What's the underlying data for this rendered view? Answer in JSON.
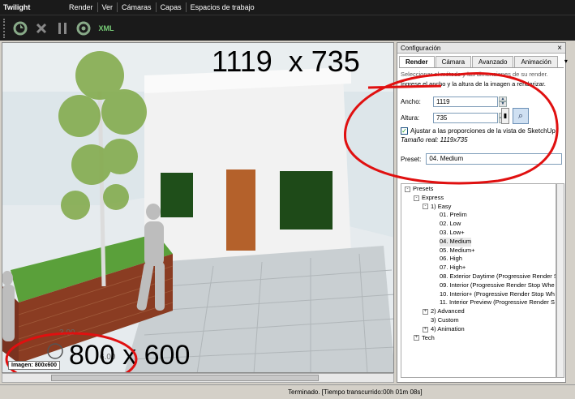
{
  "app": {
    "title": "Twilight"
  },
  "menu": [
    "Render",
    "Ver",
    "Cámaras",
    "Capas",
    "Espacios de trabajo"
  ],
  "toolbar": {
    "xml_label": "XML"
  },
  "viewport": {
    "overlay_top": "1119  x 735",
    "overlay_bottom": "800 x 600",
    "image_label": "Imagen: 800x600"
  },
  "panel": {
    "title": "Configuración",
    "close": "×",
    "tabs": [
      "Render",
      "Cámara",
      "Avanzado",
      "Animación"
    ],
    "tab_more": "▾",
    "hint": "Seleccionar el método y las dimensiones de su render.",
    "instruction": "Ingrese el ancho y la altura de la imagen a renderizar.",
    "width_label": "Ancho:",
    "width_value": "1119",
    "height_label": "Altura:",
    "height_value": "735",
    "aspect_checkbox": "Ajustar a las proporciones de la vista de SketchUp",
    "aspect_checked": true,
    "real_size": "Tamaño real: 1119x735",
    "preset_label": "Preset:",
    "preset_value": "04. Medium"
  },
  "tree": [
    {
      "label": "Presets",
      "level": 0,
      "exp": "-"
    },
    {
      "label": "Express",
      "level": 1,
      "exp": "-"
    },
    {
      "label": "1) Easy",
      "level": 2,
      "exp": "-"
    },
    {
      "label": "01. Prelim",
      "level": 3,
      "exp": ""
    },
    {
      "label": "02. Low",
      "level": 3,
      "exp": ""
    },
    {
      "label": "03. Low+",
      "level": 3,
      "exp": ""
    },
    {
      "label": "04. Medium",
      "level": 3,
      "exp": "",
      "selected": true
    },
    {
      "label": "05. Medium+",
      "level": 3,
      "exp": ""
    },
    {
      "label": "06. High",
      "level": 3,
      "exp": ""
    },
    {
      "label": "07. High+",
      "level": 3,
      "exp": ""
    },
    {
      "label": "08. Exterior Daytime (Progressive Render S",
      "level": 3,
      "exp": ""
    },
    {
      "label": "09. Interior (Progressive Render Stop Whe",
      "level": 3,
      "exp": ""
    },
    {
      "label": "10. Interior+ (Progressive Render Stop Wh",
      "level": 3,
      "exp": ""
    },
    {
      "label": "11. Interior Preview (Progressive Render S",
      "level": 3,
      "exp": ""
    },
    {
      "label": "2) Advanced",
      "level": 2,
      "exp": "+"
    },
    {
      "label": "3) Custom",
      "level": 2,
      "exp": ""
    },
    {
      "label": "4) Animation",
      "level": 2,
      "exp": "+"
    },
    {
      "label": "Tech",
      "level": 1,
      "exp": "+"
    }
  ],
  "status": {
    "text": "Terminado.  [Tiempo transcurrido:00h 01m 08s]"
  }
}
